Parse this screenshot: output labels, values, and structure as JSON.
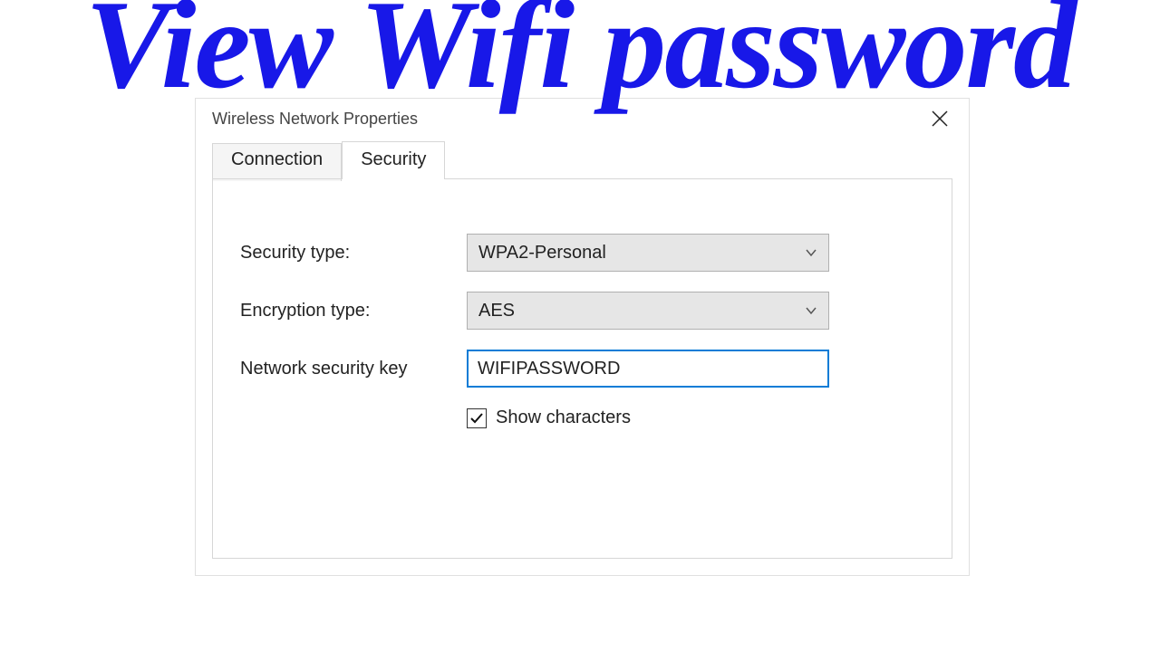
{
  "headline": "View Wifi password",
  "dialog": {
    "title": "Wireless Network Properties",
    "tabs": {
      "connection": "Connection",
      "security": "Security"
    },
    "form": {
      "security_type": {
        "label": "Security type:",
        "value": "WPA2-Personal"
      },
      "encryption_type": {
        "label": "Encryption type:",
        "value": "AES"
      },
      "network_key": {
        "label": "Network security key",
        "value": "WIFIPASSWORD"
      },
      "show_characters": {
        "label": "Show characters",
        "checked": true
      }
    }
  }
}
